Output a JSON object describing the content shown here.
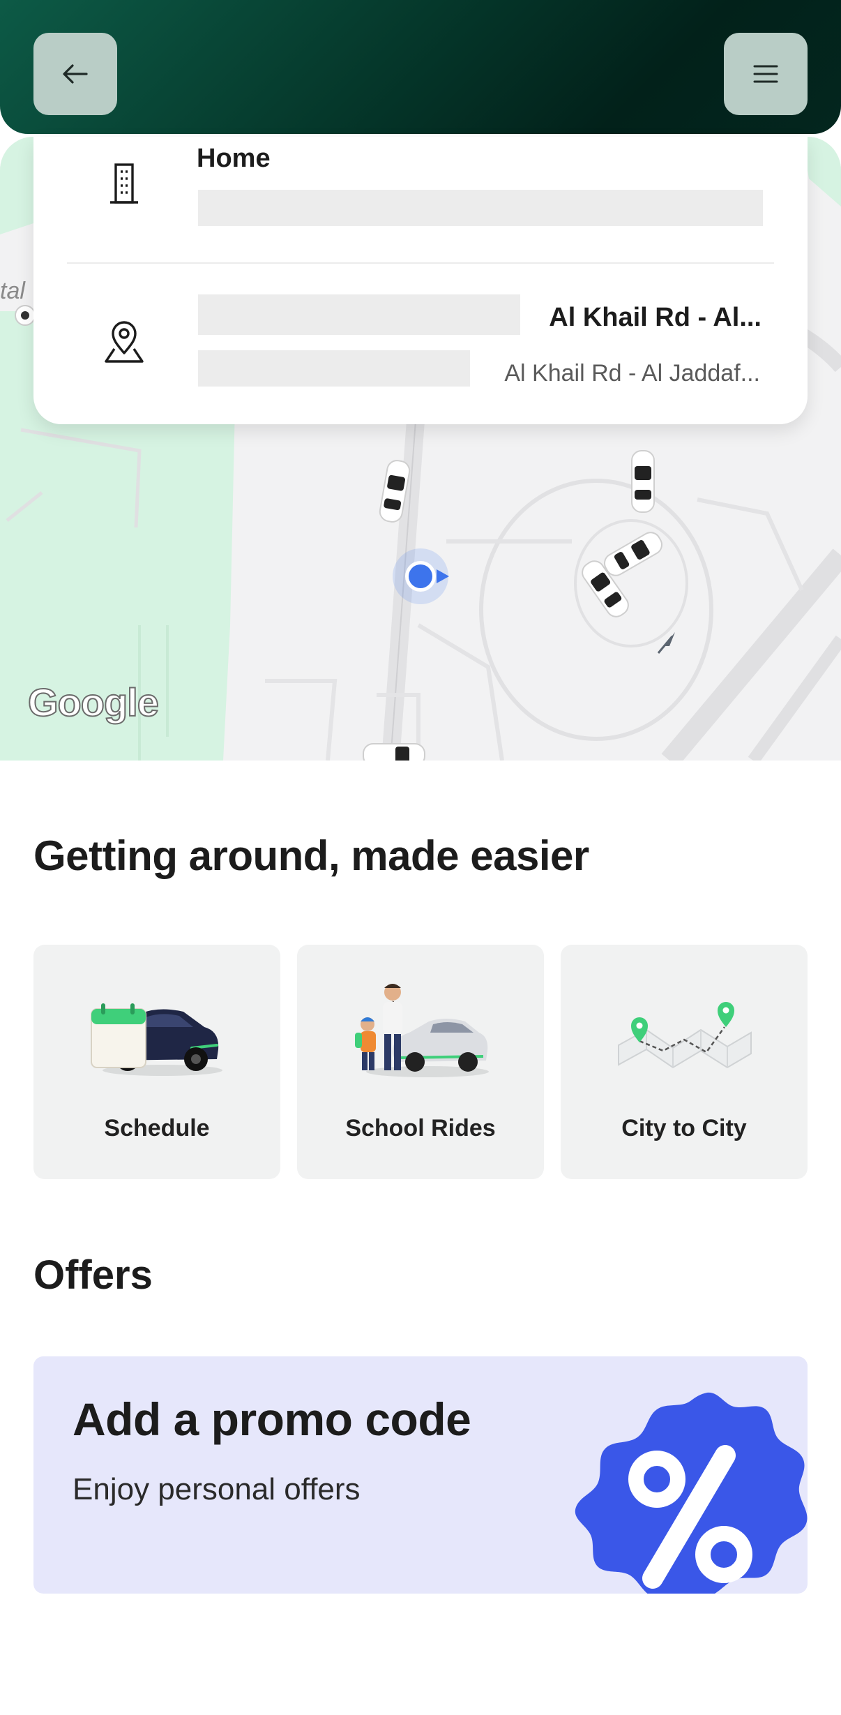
{
  "header": {
    "back_icon": "arrow-left-icon",
    "menu_icon": "hamburger-menu-icon"
  },
  "locations": {
    "home": {
      "icon": "building-icon",
      "title": "Home"
    },
    "pickup": {
      "icon": "location-pin-icon",
      "title": "Al Khail Rd - Al...",
      "subtitle": "Al Khail Rd - Al Jaddaf..."
    }
  },
  "map": {
    "attribution": "Google",
    "side_label": "tal"
  },
  "services": {
    "title": "Getting around, made easier",
    "items": [
      {
        "label": "Schedule",
        "icon": "scheduled-car-icon"
      },
      {
        "label": "School Rides",
        "icon": "school-rides-icon"
      },
      {
        "label": "City to City",
        "icon": "city-to-city-map-icon"
      }
    ]
  },
  "offers": {
    "title": "Offers",
    "promo": {
      "title": "Add a promo code",
      "subtitle": "Enjoy personal offers",
      "badge_icon": "percent-badge-icon",
      "badge_color": "#3a57e8"
    }
  },
  "colors": {
    "header_dark": "#03261e",
    "header_button": "#b9cdc6",
    "promo_bg": "#e6e7fb",
    "brand_green": "#3fcf7a"
  }
}
